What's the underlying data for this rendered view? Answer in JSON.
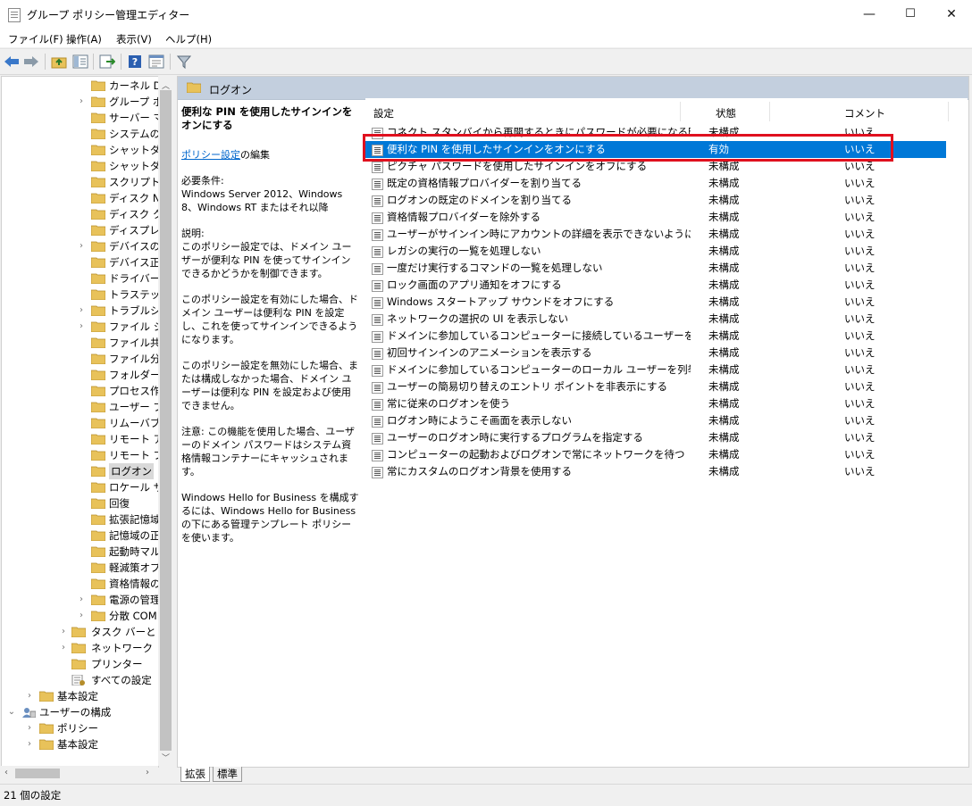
{
  "window": {
    "title": "グループ ポリシー管理エディター",
    "minimize": "—",
    "maximize": "☐",
    "close": "✕"
  },
  "menu": [
    "ファイル(F)",
    "操作(A)",
    "表示(V)",
    "ヘルプ(H)"
  ],
  "tree": {
    "items": [
      {
        "label": "カーネル DMA",
        "expandable": false
      },
      {
        "label": "グループ ポリ",
        "expandable": true
      },
      {
        "label": "サーバー マネ",
        "expandable": false
      },
      {
        "label": "システムの復",
        "expandable": false
      },
      {
        "label": "シャットダウ",
        "expandable": false
      },
      {
        "label": "シャットダウ",
        "expandable": false
      },
      {
        "label": "スクリプト",
        "expandable": false
      },
      {
        "label": "ディスク NV",
        "expandable": false
      },
      {
        "label": "ディスク クォ",
        "expandable": false
      },
      {
        "label": "ディスプレイ",
        "expandable": false
      },
      {
        "label": "デバイスのイ",
        "expandable": true
      },
      {
        "label": "デバイス正常",
        "expandable": false
      },
      {
        "label": "ドライバーの",
        "expandable": false
      },
      {
        "label": "トラステッド",
        "expandable": false
      },
      {
        "label": "トラブルシュ",
        "expandable": true
      },
      {
        "label": "ファイル シス",
        "expandable": true
      },
      {
        "label": "ファイル共有",
        "expandable": false
      },
      {
        "label": "ファイル分類",
        "expandable": false
      },
      {
        "label": "フォルダー リ",
        "expandable": false
      },
      {
        "label": "プロセス作成",
        "expandable": false
      },
      {
        "label": "ユーザー プロ",
        "expandable": false
      },
      {
        "label": "リムーバブル",
        "expandable": false
      },
      {
        "label": "リモート アシ",
        "expandable": false
      },
      {
        "label": "リモート プロ",
        "expandable": false
      },
      {
        "label": "ログオン",
        "expandable": false,
        "selected": true
      },
      {
        "label": "ロケール サー",
        "expandable": false
      },
      {
        "label": "回復",
        "expandable": false
      },
      {
        "label": "拡張記憶域",
        "expandable": false
      },
      {
        "label": "記憶域の正",
        "expandable": false
      },
      {
        "label": "起動時マル",
        "expandable": false
      },
      {
        "label": "軽減策オプ",
        "expandable": false
      },
      {
        "label": "資格情報の",
        "expandable": false
      },
      {
        "label": "電源の管理",
        "expandable": true
      },
      {
        "label": "分散 COM",
        "expandable": true
      }
    ],
    "upper": [
      {
        "label": "タスク バーと [ス",
        "expandable": true
      },
      {
        "label": "ネットワーク",
        "expandable": true
      },
      {
        "label": "プリンター",
        "expandable": false
      },
      {
        "label": "すべての設定",
        "expandable": false
      }
    ],
    "roots": [
      {
        "label": "基本設定",
        "expander": "›",
        "level": 2
      },
      {
        "label": "ユーザーの構成",
        "expander": "⌄",
        "level": 1
      },
      {
        "label": "ポリシー",
        "expander": "›",
        "level": 2
      },
      {
        "label": "基本設定",
        "expander": "›",
        "level": 2
      }
    ]
  },
  "pane": {
    "header": "ログオン",
    "description": {
      "heading": "便利な PIN を使用したサインインをオンにする",
      "edit_link": "ポリシー設定",
      "edit_suffix": "の編集",
      "requirements_label": "必要条件:",
      "requirements": "Windows Server 2012、Windows 8、Windows RT またはそれ以降",
      "explanation_label": "説明:",
      "p1": "このポリシー設定では、ドメイン ユーザーが便利な PIN を使ってサインインできるかどうかを制御できます。",
      "p2": "このポリシー設定を有効にした場合、ドメイン ユーザーは便利な PIN を設定し、これを使ってサインインできるようになります。",
      "p3": "このポリシー設定を無効にした場合、または構成しなかった場合、ドメイン ユーザーは便利な PIN を設定および使用できません。",
      "p4": "注意: この機能を使用した場合、ユーザーのドメイン パスワードはシステム資格情報コンテナーにキャッシュされます。",
      "p5": "Windows Hello for Business を構成するには、Windows Hello for Business の下にある管理テンプレート ポリシーを使います。"
    },
    "columns": {
      "setting": "設定",
      "state": "状態",
      "comment": "コメント"
    },
    "rows": [
      {
        "name": "コネクト スタンバイから再開するときにパスワードが必要になる時間を...",
        "state": "未構成",
        "comment": "いいえ"
      },
      {
        "name": "便利な PIN を使用したサインインをオンにする",
        "state": "有効",
        "comment": "いいえ",
        "selected": true
      },
      {
        "name": "ピクチャ パスワードを使用したサインインをオフにする",
        "state": "未構成",
        "comment": "いいえ"
      },
      {
        "name": "既定の資格情報プロバイダーを割り当てる",
        "state": "未構成",
        "comment": "いいえ"
      },
      {
        "name": "ログオンの既定のドメインを割り当てる",
        "state": "未構成",
        "comment": "いいえ"
      },
      {
        "name": "資格情報プロバイダーを除外する",
        "state": "未構成",
        "comment": "いいえ"
      },
      {
        "name": "ユーザーがサインイン時にアカウントの詳細を表示できないようにブロッ...",
        "state": "未構成",
        "comment": "いいえ"
      },
      {
        "name": "レガシの実行の一覧を処理しない",
        "state": "未構成",
        "comment": "いいえ"
      },
      {
        "name": "一度だけ実行するコマンドの一覧を処理しない",
        "state": "未構成",
        "comment": "いいえ"
      },
      {
        "name": "ロック画面のアプリ通知をオフにする",
        "state": "未構成",
        "comment": "いいえ"
      },
      {
        "name": "Windows スタートアップ サウンドをオフにする",
        "state": "未構成",
        "comment": "いいえ"
      },
      {
        "name": "ネットワークの選択の UI を表示しない",
        "state": "未構成",
        "comment": "いいえ"
      },
      {
        "name": "ドメインに参加しているコンピューターに接続しているユーザーを列挙し...",
        "state": "未構成",
        "comment": "いいえ"
      },
      {
        "name": "初回サインインのアニメーションを表示する",
        "state": "未構成",
        "comment": "いいえ"
      },
      {
        "name": "ドメインに参加しているコンピューターのローカル ユーザーを列挙する",
        "state": "未構成",
        "comment": "いいえ"
      },
      {
        "name": "ユーザーの簡易切り替えのエントリ ポイントを非表示にする",
        "state": "未構成",
        "comment": "いいえ"
      },
      {
        "name": "常に従来のログオンを使う",
        "state": "未構成",
        "comment": "いいえ"
      },
      {
        "name": "ログオン時にようこそ画面を表示しない",
        "state": "未構成",
        "comment": "いいえ"
      },
      {
        "name": "ユーザーのログオン時に実行するプログラムを指定する",
        "state": "未構成",
        "comment": "いいえ"
      },
      {
        "name": "コンピューターの起動およびログオンで常にネットワークを待つ",
        "state": "未構成",
        "comment": "いいえ"
      },
      {
        "name": "常にカスタムのログオン背景を使用する",
        "state": "未構成",
        "comment": "いいえ"
      }
    ]
  },
  "tabs": [
    "拡張",
    "標準"
  ],
  "status": "21 個の設定",
  "colors": {
    "accent": "#0078d7",
    "highlight_box": "#e0101e",
    "pane_header": "#c3cfde",
    "folder": "#e8c25a"
  }
}
